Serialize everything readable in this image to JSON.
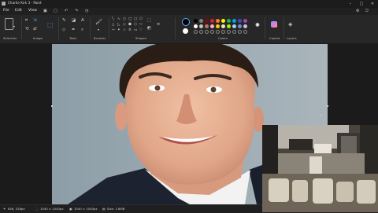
{
  "window": {
    "title": "Charlie Kirk 3 - Paint"
  },
  "menu": {
    "file": "File",
    "edit": "Edit",
    "view": "View"
  },
  "quick_access": {
    "save": "save-icon",
    "new": "new-icon",
    "undo": "undo-icon",
    "redo": "redo-icon",
    "history": "history-icon"
  },
  "ribbon": {
    "groups": {
      "selection": "Selection",
      "image": "Image",
      "tools": "Tools",
      "brushes": "Brushes",
      "shapes": "Shapes",
      "colors": "Colors",
      "copilot": "Copilot",
      "layers": "Layers"
    },
    "palette_row1": [
      "#000000",
      "#7f7f7f",
      "#880015",
      "#ed1c24",
      "#ff7f27",
      "#fff200",
      "#22b14c",
      "#00a2e8",
      "#3f48cc",
      "#a349a4"
    ],
    "palette_row2": [
      "#ffffff",
      "#c3c3c3",
      "#b97a57",
      "#ffaec9",
      "#ffc90e",
      "#efe4b0",
      "#b5e61d",
      "#99d9ea",
      "#7092be",
      "#c8bfe7"
    ]
  },
  "status": {
    "cursor": "846, 528px",
    "selection": "1040 × 1040px",
    "canvas_size": "1040 × 1040px",
    "file_size": "Size: 1.6MB"
  }
}
